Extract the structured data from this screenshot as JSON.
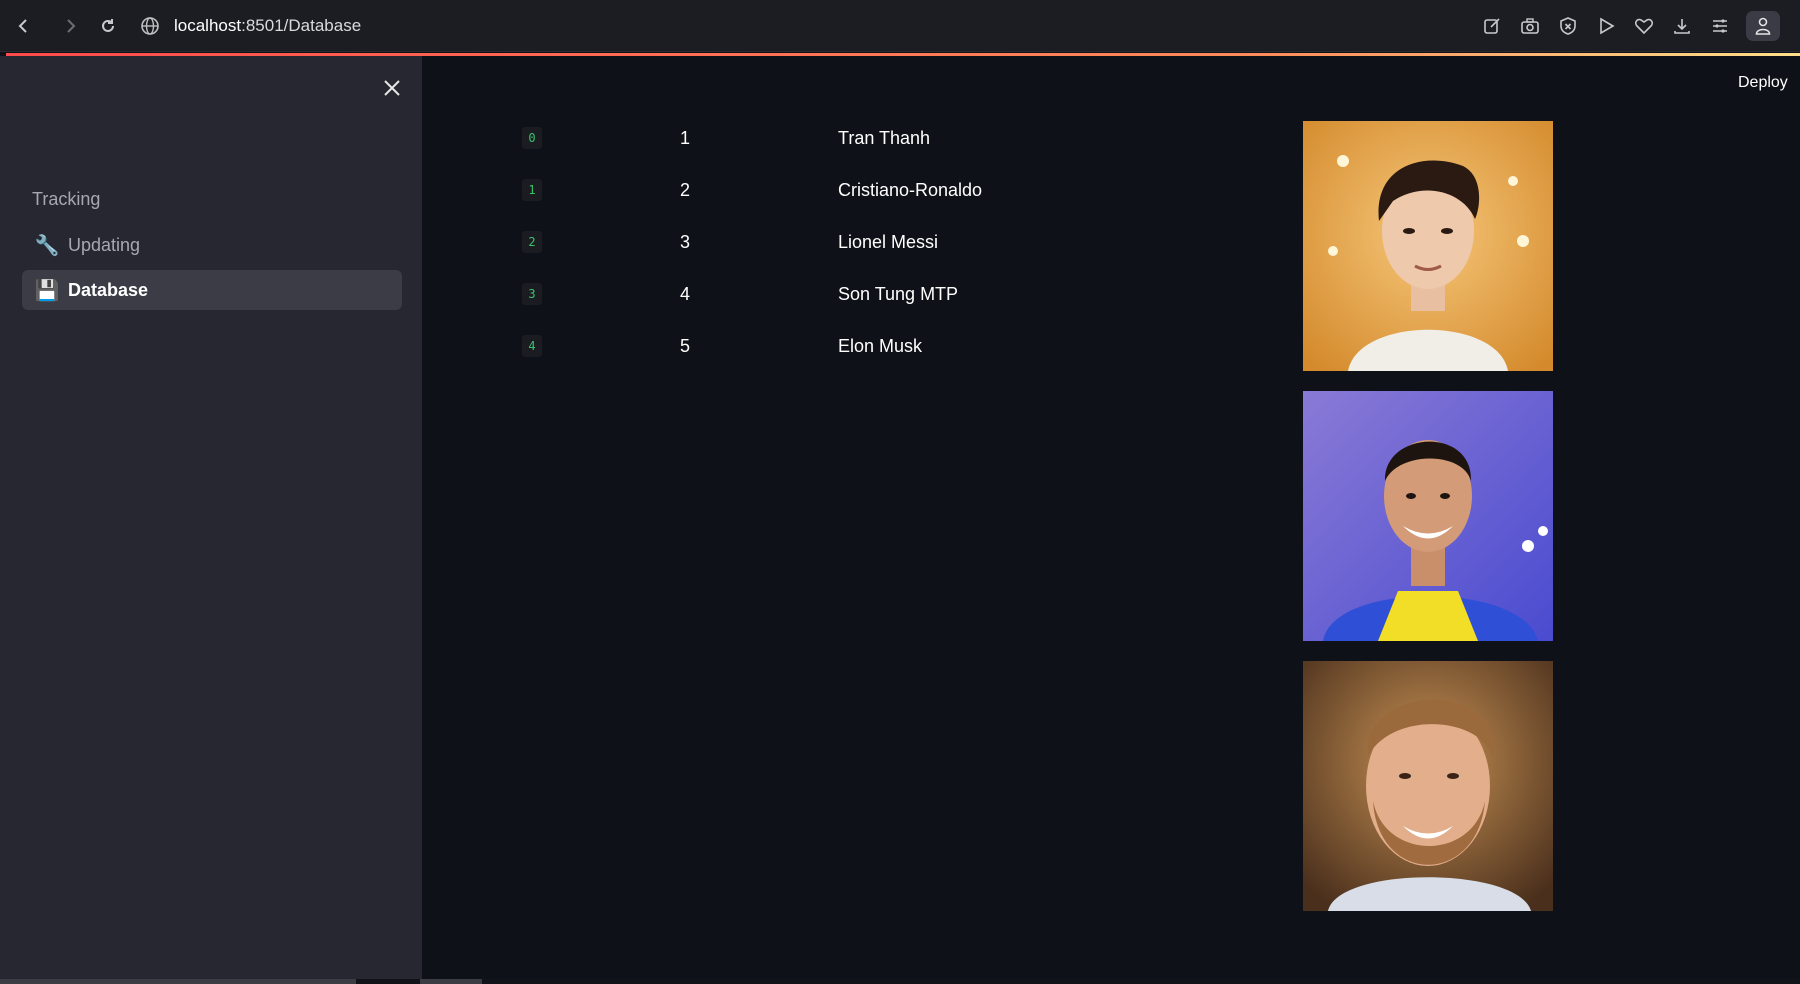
{
  "browser": {
    "url_host": "localhost",
    "url_rest": ":8501/Database",
    "icons": [
      "back-icon",
      "forward-icon",
      "reload-icon",
      "globe-icon",
      "edit-icon",
      "camera-icon",
      "shield-icon",
      "play-icon",
      "heart-icon",
      "download-icon",
      "menu-icon",
      "profile-icon"
    ]
  },
  "sidebar": {
    "close_icon": "×",
    "heading": "Tracking",
    "items": [
      {
        "label": "Updating",
        "icon": "🔧"
      },
      {
        "label": "Database",
        "icon": "💾"
      }
    ]
  },
  "header": {
    "deploy_label": "Deploy"
  },
  "table": {
    "rows": [
      {
        "index": "0",
        "id": "1",
        "name": "Tran Thanh"
      },
      {
        "index": "1",
        "id": "2",
        "name": "Cristiano-Ronaldo"
      },
      {
        "index": "2",
        "id": "3",
        "name": "Lionel Messi"
      },
      {
        "index": "3",
        "id": "4",
        "name": "Son Tung MTP"
      },
      {
        "index": "4",
        "id": "5",
        "name": "Elon Musk"
      }
    ]
  },
  "colors": {
    "background": "#0e1117",
    "sidebar": "#262730",
    "index_text": "#3ac26b",
    "accent_line": "#ff4b4b"
  }
}
